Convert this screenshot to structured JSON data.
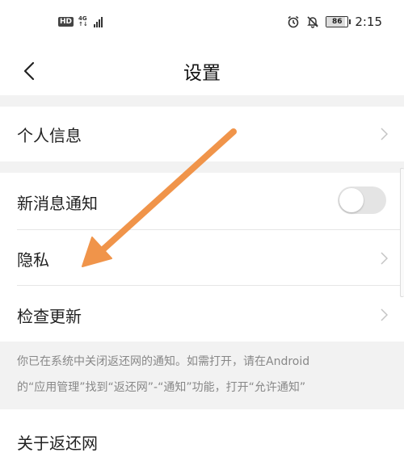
{
  "status_bar": {
    "hd_badge": "HD",
    "network_type": "4G",
    "network_sub": "↑↓",
    "time": "2:15",
    "battery_level": "86",
    "battery_percent": 86,
    "icons": [
      "signal-icon",
      "alarm-icon",
      "bell-off-icon",
      "battery-icon"
    ]
  },
  "header": {
    "title": "设置",
    "back_icon": "chevron-left-icon"
  },
  "settings": {
    "personal_info": "个人信息",
    "new_message_notification": "新消息通知",
    "notification_toggle_on": false,
    "privacy": "隐私",
    "check_updates": "检查更新",
    "about": "关于返还网"
  },
  "notice": {
    "line1": "你已在系统中关闭返还网的通知。如需打开，请在Android",
    "line2": "的“应用管理”找到“返还网”-“通知”功能，打开“允许通知”"
  },
  "colors": {
    "accent_arrow": "#f0944a",
    "section_gap": "#f2f2f2",
    "notice_text": "#888888",
    "toggle_off": "#e4e4e4"
  }
}
